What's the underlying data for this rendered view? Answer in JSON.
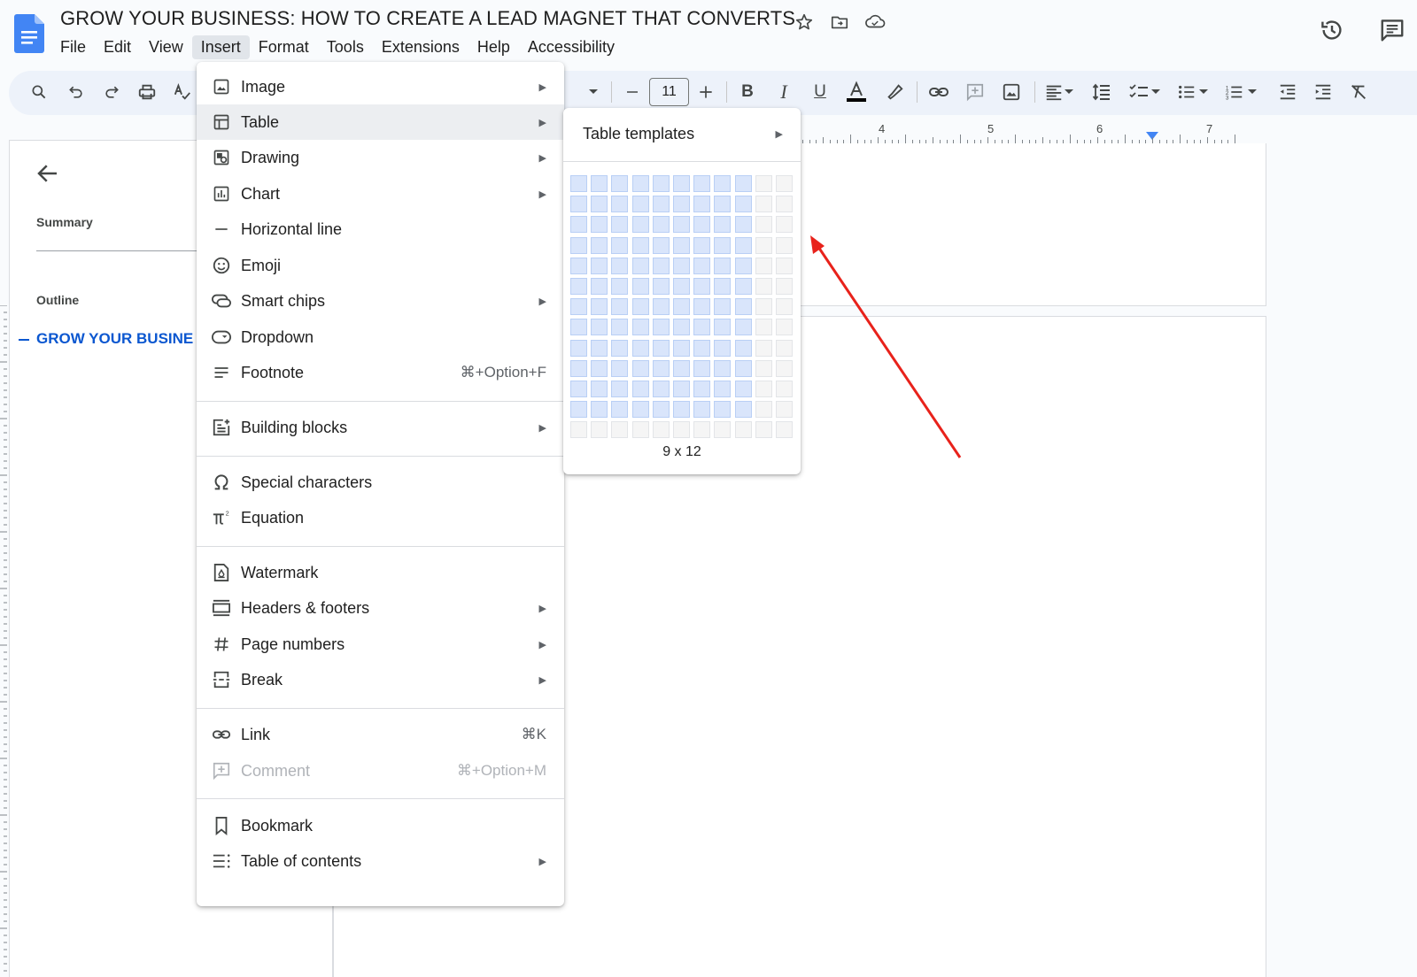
{
  "doc": {
    "title": "GROW YOUR BUSINESS: HOW TO CREATE A LEAD MAGNET THAT CONVERTS"
  },
  "menubar": [
    "File",
    "Edit",
    "View",
    "Insert",
    "Format",
    "Tools",
    "Extensions",
    "Help",
    "Accessibility"
  ],
  "menubar_active": "Insert",
  "toolbar": {
    "font_size": "11"
  },
  "sidebar": {
    "summary_label": "Summary",
    "outline_label": "Outline",
    "outline_item": "GROW YOUR BUSINE"
  },
  "ruler": {
    "numbers": [
      "4",
      "5",
      "6",
      "7"
    ]
  },
  "insert_menu": {
    "items": [
      {
        "label": "Image",
        "icon": "image-icon",
        "submenu": true
      },
      {
        "label": "Table",
        "icon": "table-icon",
        "submenu": true,
        "hover": true
      },
      {
        "label": "Drawing",
        "icon": "drawing-icon",
        "submenu": true
      },
      {
        "label": "Chart",
        "icon": "chart-icon",
        "submenu": true
      },
      {
        "label": "Horizontal line",
        "icon": "horizontal-line-icon"
      },
      {
        "label": "Emoji",
        "icon": "emoji-icon"
      },
      {
        "label": "Smart chips",
        "icon": "smart-chips-icon",
        "submenu": true
      },
      {
        "label": "Dropdown",
        "icon": "dropdown-icon"
      },
      {
        "label": "Footnote",
        "icon": "footnote-icon",
        "shortcut": "⌘+Option+F"
      },
      {
        "label": "Building blocks",
        "icon": "building-blocks-icon",
        "submenu": true
      },
      {
        "label": "Special characters",
        "icon": "omega-icon"
      },
      {
        "label": "Equation",
        "icon": "pi-icon"
      },
      {
        "label": "Watermark",
        "icon": "watermark-icon"
      },
      {
        "label": "Headers & footers",
        "icon": "headers-footers-icon",
        "submenu": true
      },
      {
        "label": "Page numbers",
        "icon": "hash-icon",
        "submenu": true
      },
      {
        "label": "Break",
        "icon": "break-icon",
        "submenu": true
      },
      {
        "label": "Link",
        "icon": "link-icon",
        "shortcut": "⌘K"
      },
      {
        "label": "Comment",
        "icon": "comment-icon",
        "shortcut": "⌘+Option+M",
        "disabled": true
      },
      {
        "label": "Bookmark",
        "icon": "bookmark-icon"
      },
      {
        "label": "Table of contents",
        "icon": "toc-icon",
        "submenu": true
      }
    ]
  },
  "table_submenu": {
    "templates_label": "Table templates",
    "grid_columns": 11,
    "grid_rows": 13,
    "selected_columns": 9,
    "selected_rows": 12,
    "size_label": "9 x 12"
  },
  "colors": {
    "accent": "#0b57d0",
    "annotation_arrow": "#e8221b",
    "grid_selected": "#d9e5fb"
  }
}
